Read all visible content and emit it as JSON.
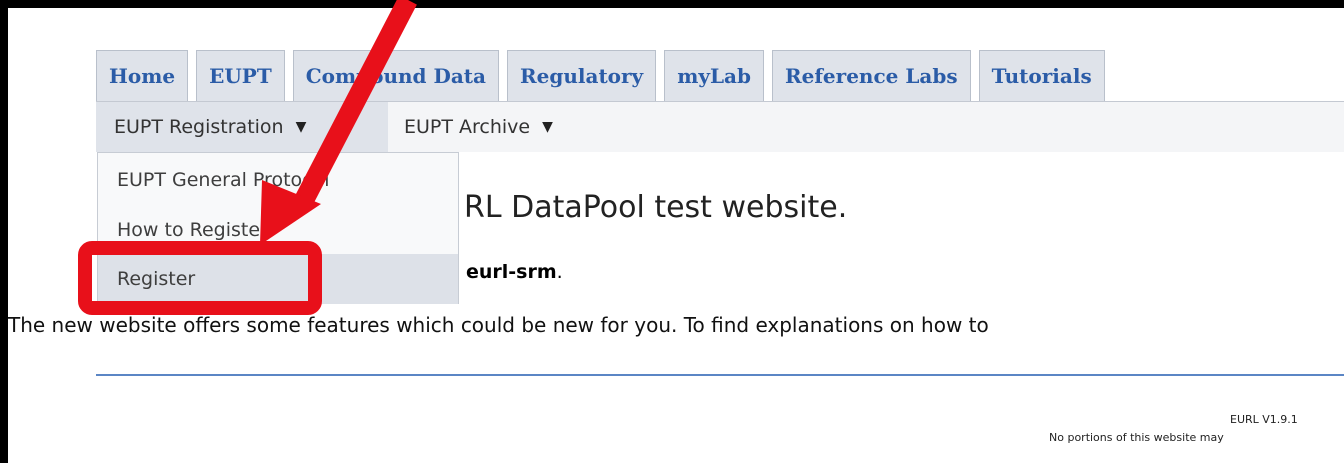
{
  "tabs": [
    "Home",
    "EUPT",
    "Compound Data",
    "Regulatory",
    "myLab",
    "Reference Labs",
    "Tutorials"
  ],
  "subnav": {
    "item1": "EUPT Registration",
    "item2": "EUPT Archive",
    "arrow": "▼"
  },
  "dropdown": [
    "EUPT General Protocol",
    "How to Register",
    "Register"
  ],
  "content": {
    "heading": "RL DataPool test website.",
    "user": "eurl-srm",
    "user_suffix": ".",
    "body": "The new website offers some features which could be new for you. To find explanations on how to"
  },
  "footer": {
    "version": "EURL V1.9.1",
    "disclaimer": "No portions of this website may"
  },
  "colors": {
    "tab_text": "#2b5ca7",
    "annotation": "#e8101a",
    "rule": "#5b86c5"
  },
  "icons": [
    "red-arrow-annotation-icon",
    "red-highlight-box"
  ]
}
